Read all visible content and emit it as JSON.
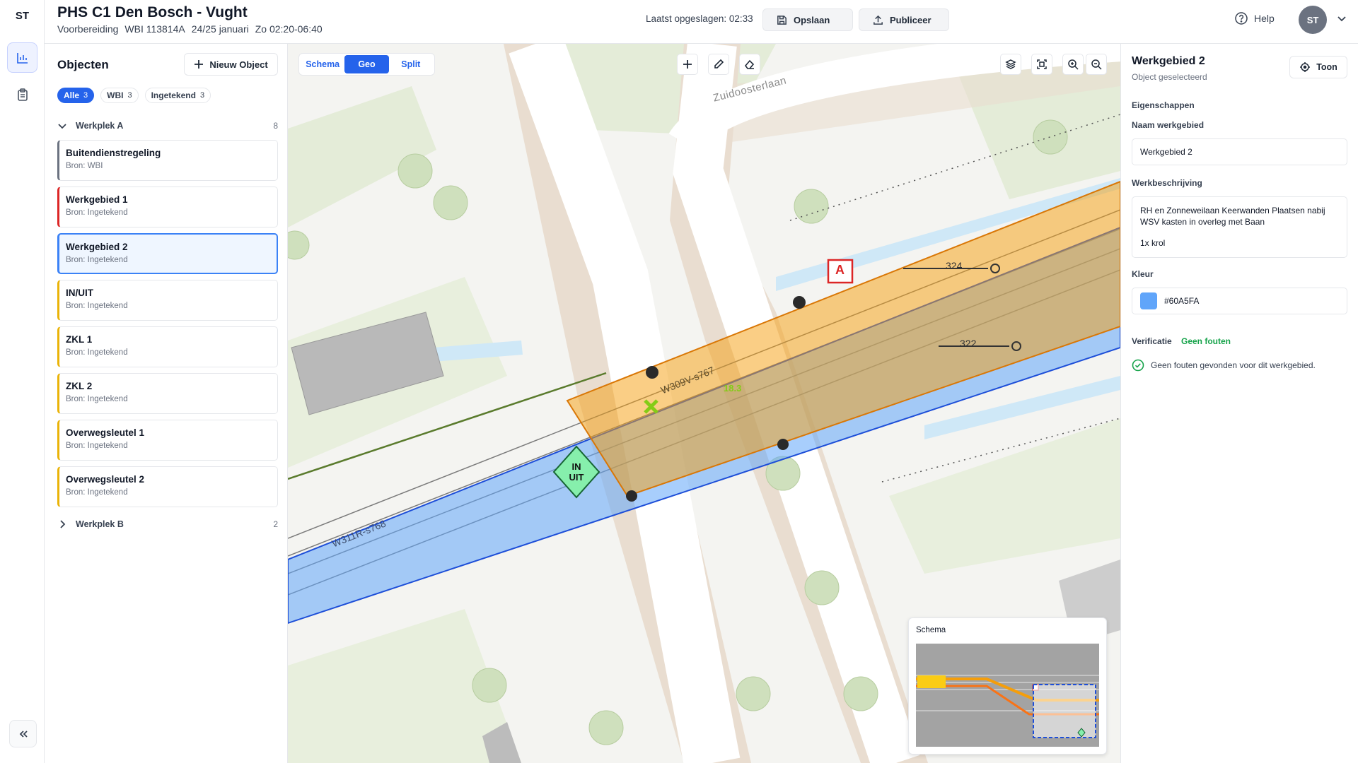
{
  "rail": {
    "logo": "ST",
    "icons": [
      "chart-icon",
      "clipboard-icon",
      "collapse-icon"
    ]
  },
  "header": {
    "title": "PHS C1 Den Bosch - Vught",
    "phase": "Voorbereiding",
    "wbi": "WBI 113814A",
    "date": "24/25 januari",
    "time": "Zo 02:20-06:40",
    "saved_text": "Laatst opgeslagen: 02:33",
    "save_label": "Opslaan",
    "publish_label": "Publiceer",
    "help_label": "Help",
    "avatar_initials": "ST"
  },
  "objects": {
    "title": "Objecten",
    "new_label": "Nieuw Object",
    "filters": [
      {
        "label": "Alle",
        "count": "3"
      },
      {
        "label": "WBI",
        "count": "3"
      },
      {
        "label": "Ingetekend",
        "count": "3"
      }
    ],
    "group_a": {
      "label": "Werkplek A",
      "count": "8"
    },
    "group_b": {
      "label": "Werkplek B",
      "count": "2"
    },
    "items": [
      {
        "name": "Buitendienstregeling",
        "source": "Bron: WBI",
        "color": "#6b7280"
      },
      {
        "name": "Werkgebied 1",
        "source": "Bron: Ingetekend",
        "color": "#dc2626"
      },
      {
        "name": "Werkgebied 2",
        "source": "Bron: Ingetekend",
        "color": "#3b82f6"
      },
      {
        "name": "IN/UIT",
        "source": "Bron: Ingetekend",
        "color": "#eab308"
      },
      {
        "name": "ZKL 1",
        "source": "Bron: Ingetekend",
        "color": "#eab308"
      },
      {
        "name": "ZKL 2",
        "source": "Bron: Ingetekend",
        "color": "#eab308"
      },
      {
        "name": "Overwegsleutel 1",
        "source": "Bron: Ingetekend",
        "color": "#eab308"
      },
      {
        "name": "Overwegsleutel 2",
        "source": "Bron: Ingetekend",
        "color": "#eab308"
      }
    ]
  },
  "map": {
    "view_tabs": [
      "Schema",
      "Geo",
      "Split"
    ],
    "active_view": "Geo",
    "street_name": "Zuidoosterlaan",
    "track_label_1": "W309V-s767",
    "track_label_2": "W311R-s768",
    "km_label": "18.3",
    "marker_a": "A",
    "in_uit_in": "IN",
    "in_uit_uit": "UIT",
    "signal_324": "324",
    "signal_322": "322",
    "minimap_title": "Schema",
    "orange_color": "#f59e0b",
    "blue_color": "#60A5FA"
  },
  "props": {
    "title": "Werkgebied 2",
    "subtitle": "Object geselecteerd",
    "toon_label": "Toon",
    "section_label": "Eigenschappen",
    "name_label": "Naam werkgebied",
    "name_value": "Werkgebied 2",
    "desc_label": "Werkbeschrijving",
    "desc_line1": "RH en Zonneweilaan Keerwanden Plaatsen nabij WSV kasten in overleg met Baan",
    "desc_line2": "1x krol",
    "color_label": "Kleur",
    "color_value": "#60A5FA",
    "verif_label": "Verificatie",
    "verif_status": "Geen fouten",
    "verif_message": "Geen fouten gevonden voor dit werkgebied."
  }
}
